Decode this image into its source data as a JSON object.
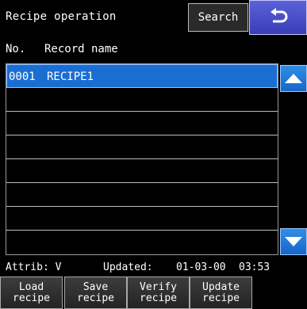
{
  "header": {
    "title": "Recipe operation",
    "search_label": "Search",
    "back_icon": "return-arrow-icon"
  },
  "columns": {
    "no": "No.",
    "record_name": "Record name"
  },
  "records": [
    {
      "no": "0001",
      "name": "RECIPE1",
      "selected": true
    },
    {
      "no": "",
      "name": ""
    },
    {
      "no": "",
      "name": ""
    },
    {
      "no": "",
      "name": ""
    },
    {
      "no": "",
      "name": ""
    },
    {
      "no": "",
      "name": ""
    },
    {
      "no": "",
      "name": ""
    },
    {
      "no": "",
      "name": ""
    }
  ],
  "status": {
    "attrib": "Attrib: V",
    "updated_label": "Updated:",
    "date": "01-03-00",
    "time": "03:53"
  },
  "buttons": [
    {
      "line1": "Load",
      "line2": "recipe"
    },
    {
      "line1": "Save",
      "line2": "recipe"
    },
    {
      "line1": "Verify",
      "line2": "recipe"
    },
    {
      "line1": "Update",
      "line2": "recipe"
    }
  ],
  "colors": {
    "selected_row": "#1a6ed2",
    "back_button": "#4a50cc",
    "scroll_button": "#2478d8"
  }
}
